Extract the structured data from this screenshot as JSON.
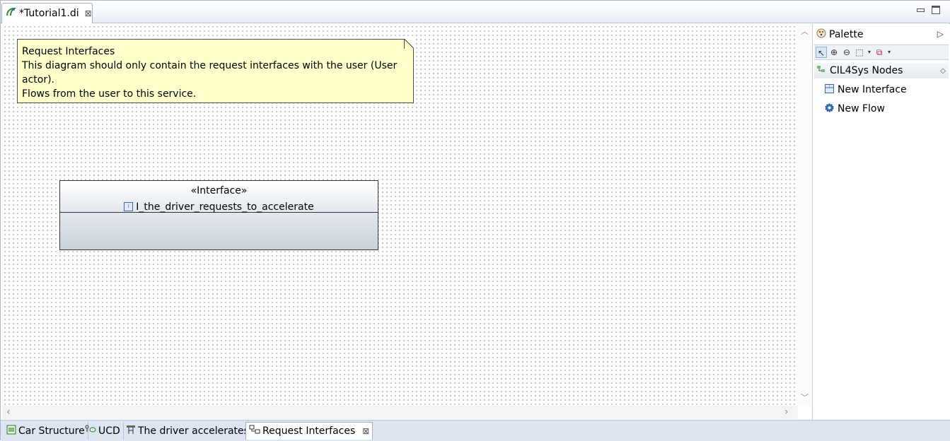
{
  "editor": {
    "tab_title": "*Tutorial1.di",
    "close_glyph": "⊠"
  },
  "note": {
    "title": "Request Interfaces",
    "line1": "This diagram should only contain the request interfaces with the user (User actor).",
    "line2": "Flows from the user to this service."
  },
  "interface_box": {
    "stereotype": "«Interface»",
    "name": "I_the_driver_requests_to_accelerate"
  },
  "palette": {
    "title": "Palette",
    "drawer": "CIL4Sys Nodes",
    "items": [
      {
        "label": "New Interface",
        "icon": "interface-icon"
      },
      {
        "label": "New Flow",
        "icon": "gear-icon"
      }
    ]
  },
  "bottom_tabs": [
    {
      "label": "Car Structure",
      "icon": "structure-icon"
    },
    {
      "label": "UCD",
      "icon": "usecase-icon"
    },
    {
      "label": "The driver accelerates",
      "icon": "activity-icon"
    },
    {
      "label": "Request Interfaces",
      "icon": "class-diagram-icon",
      "active": true
    }
  ],
  "colors": {
    "note_bg": "#ffffcc",
    "accent": "#3a6aa6",
    "chrome": "#dce5f0"
  }
}
